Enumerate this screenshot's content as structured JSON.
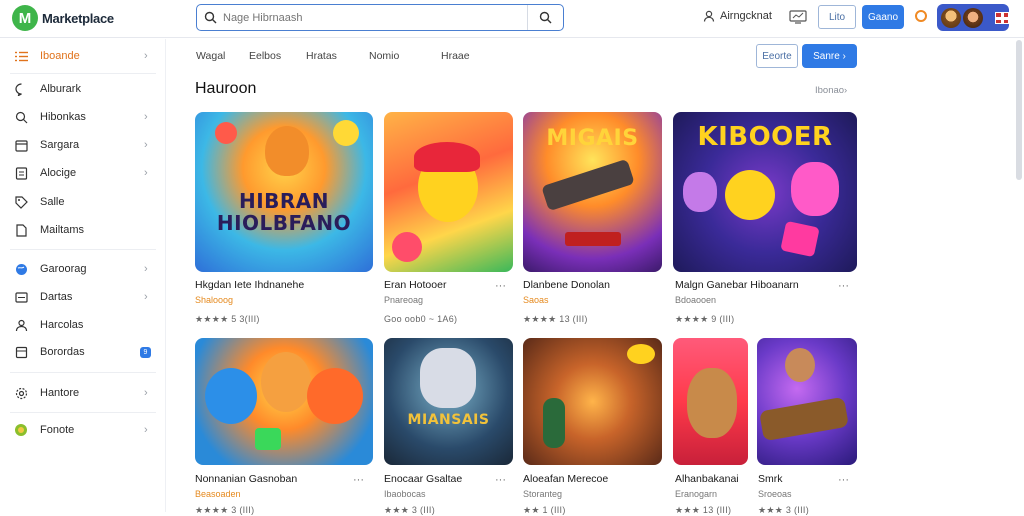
{
  "app": {
    "logo_letter": "M",
    "name": "Marketplace"
  },
  "search": {
    "placeholder": "Nage Hibrnaash"
  },
  "header": {
    "account_label": "Airngcknat",
    "btn_outline": "Lito",
    "btn_primary": "Gaano"
  },
  "sidebar": {
    "items": [
      {
        "label": "Iboande",
        "icon": "list-icon",
        "chevron": "›",
        "active": true
      },
      {
        "label": "Alburark",
        "icon": "chat-icon",
        "chevron": ""
      },
      {
        "label": "Hibonkas",
        "icon": "search-icon",
        "chevron": "›"
      },
      {
        "label": "Sargara",
        "icon": "calendar-icon",
        "chevron": "›"
      },
      {
        "label": "Alocige",
        "icon": "document-icon",
        "chevron": "›"
      },
      {
        "label": "Salle",
        "icon": "tag-icon",
        "chevron": ""
      },
      {
        "label": "Mailtams",
        "icon": "file-icon",
        "chevron": ""
      },
      {
        "label": "Garoorag",
        "icon": "globe-icon",
        "chevron": "›"
      },
      {
        "label": "Dartas",
        "icon": "grid-icon",
        "chevron": "›"
      },
      {
        "label": "Harcolas",
        "icon": "people-icon",
        "chevron": ""
      },
      {
        "label": "Borordas",
        "icon": "box-icon",
        "chevron": "",
        "badge": "9"
      },
      {
        "label": "Hantore",
        "icon": "settings-icon",
        "chevron": "›"
      },
      {
        "label": "Fonote",
        "icon": "ball-icon",
        "chevron": "›"
      }
    ]
  },
  "tabs": [
    "Wagal",
    "Eelbos",
    "Hratas",
    "Nomio",
    "Hraae"
  ],
  "actions": {
    "outline_label": "Eeorte",
    "primary_label": "Sanre ›"
  },
  "section": {
    "title": "Hauroon",
    "see_all": "Ibonao›"
  },
  "cards": [
    {
      "title": "Hkgdan Iete Ihdnanehe",
      "subtitle": "Shalooog",
      "rating": "★★★★ 5 3(III)",
      "art_text": "HIBRAN HIOLBFANO",
      "more": "",
      "sub_color": "orange"
    },
    {
      "title": "Eran Hotooer",
      "subtitle": "Pnareoag",
      "rating": "Goo oob0 ~ 1A6)",
      "art_text": "",
      "more": "···",
      "sub_color": "gray"
    },
    {
      "title": "Dlanbene Donolan",
      "subtitle": "Saoas",
      "rating": "★★★★ 13 (III)",
      "art_text": "MIGAIS",
      "more": "",
      "sub_color": "orange"
    },
    {
      "title": "Malgn Ganebar Hiboanarn",
      "subtitle": "Bdoaooen",
      "rating": "★★★★ 9 (III)",
      "art_text": "KIBOOER",
      "more": "···",
      "sub_color": "gray"
    },
    {
      "title": "Nonnanian Gasnoban",
      "subtitle": "Beasoaden",
      "rating": "★★★★ 3 (III)",
      "art_text": "",
      "more": "···",
      "sub_color": "orange"
    },
    {
      "title": "Enocaar Gsaltae",
      "subtitle": "Ibaobocas",
      "rating": "★★★ 3 (III)",
      "art_text": "MIANSAIS",
      "more": "···",
      "sub_color": "gray"
    },
    {
      "title": "Aloeafan Merecoe",
      "subtitle": "Storanteg",
      "rating": "★★ 1 (III)",
      "art_text": "",
      "more": "",
      "sub_color": "gray"
    },
    {
      "title": "Alhanbakanai",
      "subtitle": "Eranogarn",
      "rating": "★★★ 13 (III)",
      "art_text": "",
      "more": "",
      "sub_color": "gray"
    },
    {
      "title": "Smrk",
      "subtitle": "Sroeoas",
      "rating": "★★★ 3 (III)",
      "art_text": "",
      "more": "···",
      "sub_color": "gray"
    }
  ],
  "colors": {
    "accent": "#2f7ae5",
    "active": "#e0731c",
    "logo": "#3fb54a"
  }
}
